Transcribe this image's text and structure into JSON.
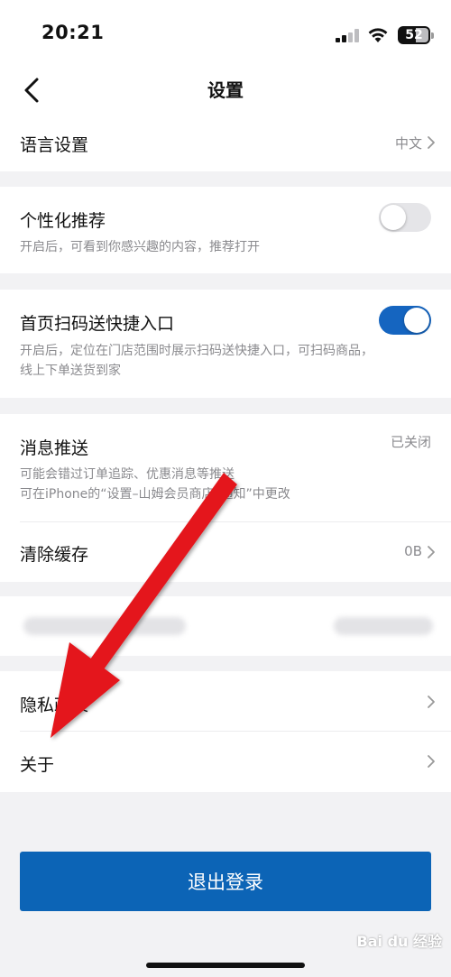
{
  "status_bar": {
    "time": "20:21",
    "battery_level": "52"
  },
  "nav": {
    "title": "设置"
  },
  "language": {
    "title": "语言设置",
    "value": "中文"
  },
  "personalized": {
    "title": "个性化推荐",
    "desc": "开启后，可看到你感兴趣的内容，推荐打开",
    "enabled": false
  },
  "scan_entry": {
    "title": "首页扫码送快捷入口",
    "desc_line1": "开启后，定位在门店范围时展示扫码送快捷入口，可扫码商品，",
    "desc_line2": "线上下单送货到家",
    "enabled": true
  },
  "notifications": {
    "title": "消息推送",
    "value": "已关闭",
    "desc_line1": "可能会错过订单追踪、优惠消息等推送",
    "desc_line2": "可在iPhone的“设置–山姆会员商店–通知”中更改"
  },
  "cache": {
    "title": "清除缓存",
    "value": "0B"
  },
  "privacy": {
    "title": "隐私政策"
  },
  "about": {
    "title": "关于"
  },
  "logout": {
    "label": "退出登录"
  },
  "watermark": {
    "text": "Bai du 经验"
  },
  "colors": {
    "accent": "#0c64b6",
    "toggle_on": "#1565c0",
    "annotation_arrow": "#e4141c"
  }
}
